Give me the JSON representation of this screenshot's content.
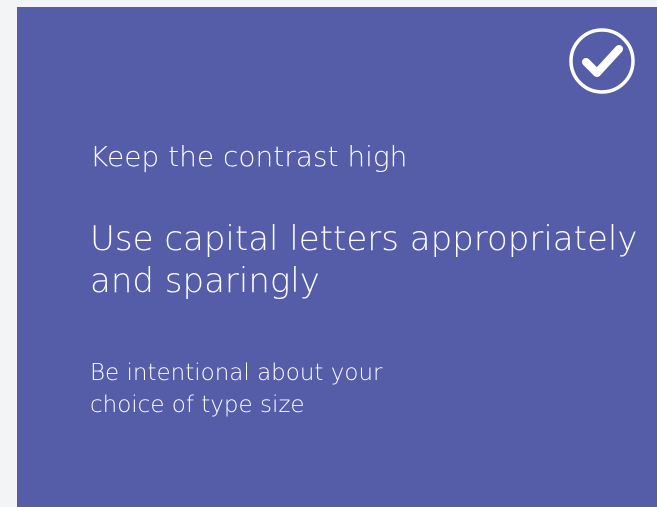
{
  "card": {
    "background": "#555ca8",
    "text_color": "#ffffff",
    "icon": "checkmark-circle-icon",
    "line1": "Keep the contrast high",
    "line2": "Use capital letters appropriately and sparingly",
    "line3": "Be intentional about your choice of type size"
  }
}
